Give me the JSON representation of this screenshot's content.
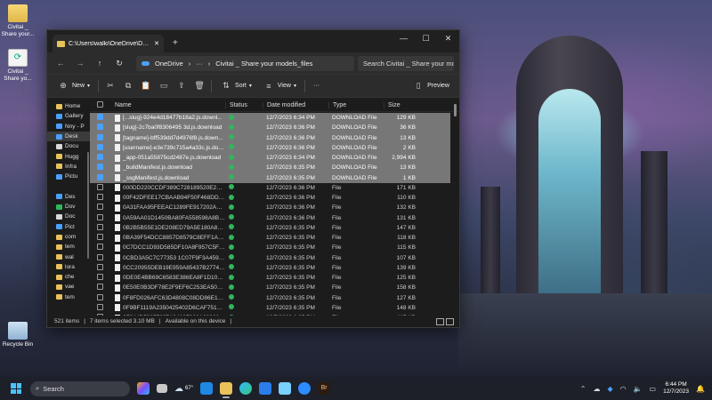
{
  "desktop": {
    "icons": [
      {
        "label": "Civitai _ Share your...",
        "kind": "folder"
      },
      {
        "label": "Civitai _ Share yo...",
        "kind": "html"
      },
      {
        "label": "Recycle Bin",
        "kind": "bin"
      }
    ]
  },
  "window": {
    "tab_title": "C:\\Users\\walki\\OneDrive\\Desk",
    "new_tab": "+",
    "controls": {
      "minimize": "—",
      "maximize": "☐",
      "close": "✕"
    },
    "nav": {
      "back": "←",
      "forward": "→",
      "up": "↑",
      "refresh": "↻"
    },
    "address": {
      "root": "OneDrive",
      "sep": "›",
      "more": "···",
      "folder": "Civitai _ Share your models_files"
    },
    "search_placeholder": "Search Civitai _ Share your mo",
    "commands": {
      "new": "New",
      "sort": "Sort",
      "view": "View",
      "more": "···",
      "preview": "Preview"
    },
    "sidebar": [
      {
        "label": "Home",
        "color": "#e9c25a"
      },
      {
        "label": "Gallery",
        "color": "#4aa0ff"
      },
      {
        "label": "Nny - P",
        "color": "#4aa0ff"
      },
      {
        "label": "Desk",
        "color": "#4aa0ff",
        "selected": true
      },
      {
        "label": "Docu",
        "color": "#d8d8d8"
      },
      {
        "label": "Hugg",
        "color": "#e9c25a"
      },
      {
        "label": "Infra",
        "color": "#e9c25a"
      },
      {
        "label": "Pictu",
        "color": "#4aa0ff"
      },
      {
        "label": "",
        "color": ""
      },
      {
        "label": "Des",
        "color": "#4aa0ff"
      },
      {
        "label": "Dov",
        "color": "#2fb65a"
      },
      {
        "label": "Doc",
        "color": "#d8d8d8"
      },
      {
        "label": "Pict",
        "color": "#4aa0ff"
      },
      {
        "label": "com",
        "color": "#e9c25a"
      },
      {
        "label": "tem",
        "color": "#e9c25a"
      },
      {
        "label": "wal",
        "color": "#e9c25a"
      },
      {
        "label": "lora",
        "color": "#e9c25a"
      },
      {
        "label": "che",
        "color": "#e9c25a"
      },
      {
        "label": "vae",
        "color": "#e9c25a"
      },
      {
        "label": "tem",
        "color": "#e9c25a"
      }
    ],
    "columns": {
      "name": "Name",
      "status": "Status",
      "date": "Date modified",
      "type": "Type",
      "size": "Size"
    },
    "files": [
      {
        "name": "[...slug]-924e4d18477b18a2.js.downl...",
        "date": "12/7/2023 6:34 PM",
        "type": "DOWNLOAD File",
        "size": "129 KB",
        "selected": true
      },
      {
        "name": "[slug]-2c7ba0f8306495 3d.js.download",
        "date": "12/7/2023 6:36 PM",
        "type": "DOWNLOAD File",
        "size": "36 KB",
        "selected": true
      },
      {
        "name": "[tagname]-bff539dd7d4976f8.js.down...",
        "date": "12/7/2023 6:36 PM",
        "type": "DOWNLOAD File",
        "size": "13 KB",
        "selected": true
      },
      {
        "name": "[username]-e3e739c715a4a33c.js.dow...",
        "date": "12/7/2023 6:36 PM",
        "type": "DOWNLOAD File",
        "size": "2 KB",
        "selected": true
      },
      {
        "name": "_app-051a55875cd2487e.js.download",
        "date": "12/7/2023 6:34 PM",
        "type": "DOWNLOAD File",
        "size": "2,994 KB",
        "selected": true
      },
      {
        "name": "_buildManifest.js.download",
        "date": "12/7/2023 6:35 PM",
        "type": "DOWNLOAD File",
        "size": "13 KB",
        "selected": true
      },
      {
        "name": "_ssgManifest.js.download",
        "date": "12/7/2023 6:35 PM",
        "type": "DOWNLOAD File",
        "size": "1 KB",
        "selected": true
      },
      {
        "name": "000DD220CCDF389C728189520E2F7E...",
        "date": "12/7/2023 6:36 PM",
        "type": "File",
        "size": "171 KB"
      },
      {
        "name": "00F42DFEE17CBAAB94F50F468DDEC...",
        "date": "12/7/2023 6:36 PM",
        "type": "File",
        "size": "110 KB"
      },
      {
        "name": "0A31FAA95FEEAC1289FE917202A7E2...",
        "date": "12/7/2023 6:36 PM",
        "type": "File",
        "size": "132 KB"
      },
      {
        "name": "0A59AA01D1450BA80FA558598A8BD8...",
        "date": "12/7/2023 6:36 PM",
        "type": "File",
        "size": "131 KB"
      },
      {
        "name": "0B2B5B55E1DE208ED79A5E180A814E...",
        "date": "12/7/2023 6:35 PM",
        "type": "File",
        "size": "147 KB"
      },
      {
        "name": "0BA39F54DCC8857D8579C8EFF1A43...",
        "date": "12/7/2023 6:35 PM",
        "type": "File",
        "size": "118 KB"
      },
      {
        "name": "0C7DCC1D93D585DF10A8F957C5F02...",
        "date": "12/7/2023 6:35 PM",
        "type": "File",
        "size": "115 KB"
      },
      {
        "name": "0CBD3A5C7C77353 1C07F9F3A459721...",
        "date": "12/7/2023 6:35 PM",
        "type": "File",
        "size": "107 KB"
      },
      {
        "name": "0CC20955DEB19E959A85437B2774A3...",
        "date": "12/7/2023 6:35 PM",
        "type": "File",
        "size": "139 KB"
      },
      {
        "name": "0DE0E4BB69C6583E386EA8F1D104C49...",
        "date": "12/7/2023 6:35 PM",
        "type": "File",
        "size": "125 KB"
      },
      {
        "name": "0E50E0B3DF78E2F9EF6C253EA509992...",
        "date": "12/7/2023 6:35 PM",
        "type": "File",
        "size": "158 KB"
      },
      {
        "name": "0F8FD026AFC63D4808C08DD86E1C2...",
        "date": "12/7/2023 6:35 PM",
        "type": "File",
        "size": "127 KB"
      },
      {
        "name": "0F9BF1119A2350425402D6CAF751AD...",
        "date": "12/7/2023 6:35 PM",
        "type": "File",
        "size": "148 KB"
      },
      {
        "name": "0F044D59857607A8418F360A603686...",
        "date": "12/7/2023 6:35 PM",
        "type": "File",
        "size": "117 KB"
      }
    ],
    "status": {
      "count": "521 items",
      "divider": "|",
      "selected": "7 items selected  3.10 MB",
      "availability": "Available on this device"
    }
  },
  "taskbar": {
    "search": "Search",
    "weather": "67°",
    "time": "6:44 PM",
    "date": "12/7/2023",
    "brand_colors": {
      "accent": "#4cc2ff",
      "taskbar": "#1d2028"
    }
  }
}
